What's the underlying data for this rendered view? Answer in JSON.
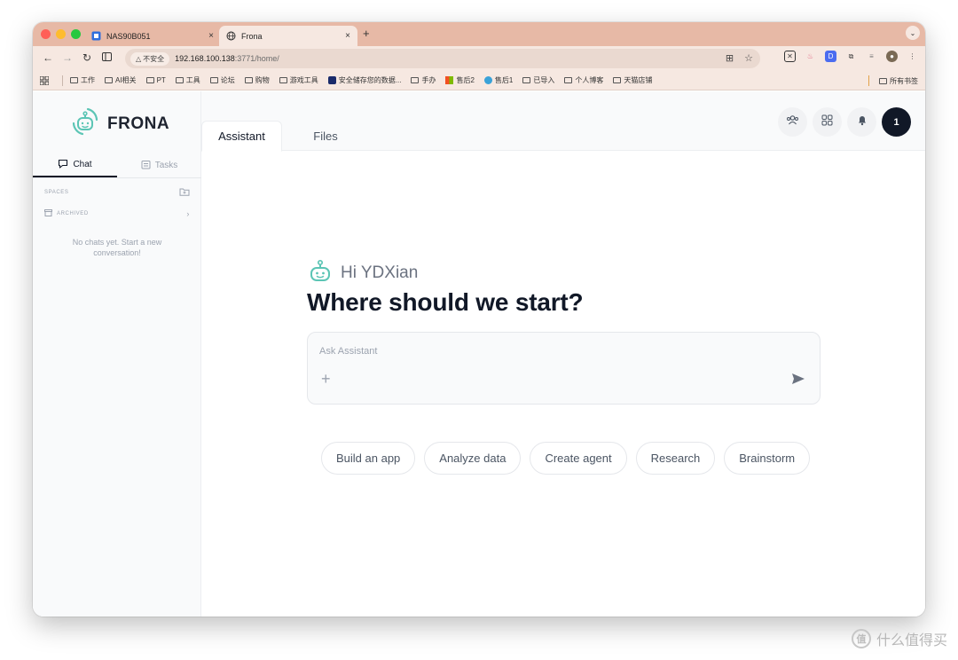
{
  "browser": {
    "tabs": [
      {
        "title": "NAS90B051",
        "favicon": "nas-icon",
        "close": "×"
      },
      {
        "title": "Frona",
        "favicon": "globe-icon",
        "close": "×"
      }
    ],
    "new_tab": "+",
    "address": {
      "security_label": "不安全",
      "host": "192.168.100.138",
      "path": ":3771/home/"
    },
    "bookmarks": [
      {
        "label": "工作"
      },
      {
        "label": "AI相关"
      },
      {
        "label": "PT"
      },
      {
        "label": "工具"
      },
      {
        "label": "论坛"
      },
      {
        "label": "购物"
      },
      {
        "label": "游戏工具"
      },
      {
        "label": "安全储存您的数据..."
      },
      {
        "label": "手办"
      },
      {
        "label": "售后2"
      },
      {
        "label": "售后1"
      },
      {
        "label": "已导入"
      },
      {
        "label": "个人博客"
      },
      {
        "label": "天猫店铺"
      }
    ],
    "all_bookmarks": "所有书签"
  },
  "sidebar": {
    "brand": "FRONA",
    "tabs": {
      "chat": "Chat",
      "tasks": "Tasks"
    },
    "spaces_label": "SPACES",
    "archived_label": "ARCHIVED",
    "empty_message": "No chats yet. Start a new conversation!"
  },
  "main": {
    "tabs": {
      "assistant": "Assistant",
      "files": "Files"
    },
    "avatar_initial": "1",
    "greeting": "Hi YDXian",
    "headline": "Where should we start?",
    "composer_placeholder": "Ask Assistant",
    "suggestions": [
      "Build an app",
      "Analyze data",
      "Create agent",
      "Research",
      "Brainstorm"
    ]
  },
  "watermark": "什么值得买",
  "colors": {
    "tab_strip": "#e7b9a6",
    "toolbar": "#f6e8e1",
    "brand_teal": "#5cc5b5",
    "avatar": "#111827"
  }
}
